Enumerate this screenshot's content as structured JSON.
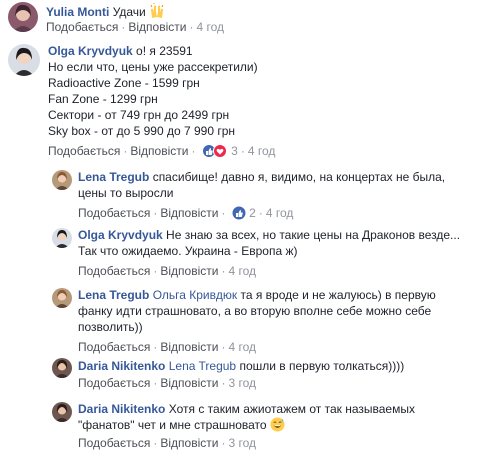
{
  "actions": {
    "like": "Подобається",
    "reply": "Відповісти",
    "sep": "·"
  },
  "comments": [
    {
      "author": "Yulia Monti",
      "text": "Удачи",
      "emoji": "raising-hands",
      "time": "4 год"
    },
    {
      "author": "Olga Kryvdyuk",
      "lines": [
        "о! я 23591",
        "Но если что, цены уже рассекретили)",
        "Radioactive Zone - 1599 грн",
        "Fan Zone - 1299 грн",
        "Сектори - от 749 грн до 2499 грн",
        "Sky box - от до 5 990 до 7 990 грн"
      ],
      "reactions": "3",
      "time": "4 год"
    }
  ],
  "replies": [
    {
      "author": "Lena Tregub",
      "lines": [
        "спасибище! давно я, видимо, на концертах не была,",
        "цены то выросли"
      ],
      "reactions": "2",
      "time": "4 год"
    },
    {
      "author": "Olga Kryvdyuk",
      "lines": [
        "Не знаю за всех, но такие цены на Драконов везде...",
        "Так что ожидаемо. Украина - Европа ж)"
      ],
      "time": "4 год"
    },
    {
      "author": "Lena Tregub",
      "mention": "Ольга Кривдюк",
      "lines": [
        "та я вроде и не жалуюсь) в первую",
        "фанку идти страшновато, а во вторую вполне себе можно себе",
        "позволить))"
      ],
      "time": "4 год"
    },
    {
      "author": "Daria Nikitenko",
      "mention": "Lena Tregub",
      "lines": [
        "пошли в первую толкаться))))"
      ],
      "time": "3 год"
    },
    {
      "author": "Daria Nikitenko",
      "lines": [
        "Хотя с таким ажиотажем от так называемых",
        "\"фанатов\" чет и мне страшновато"
      ],
      "emoji": "grinning-sweat",
      "time": "3 год"
    }
  ],
  "colors": {
    "link": "#365899",
    "meta": "#90949c",
    "like_blue": "#4267b2",
    "love_red": "#f0284a"
  }
}
